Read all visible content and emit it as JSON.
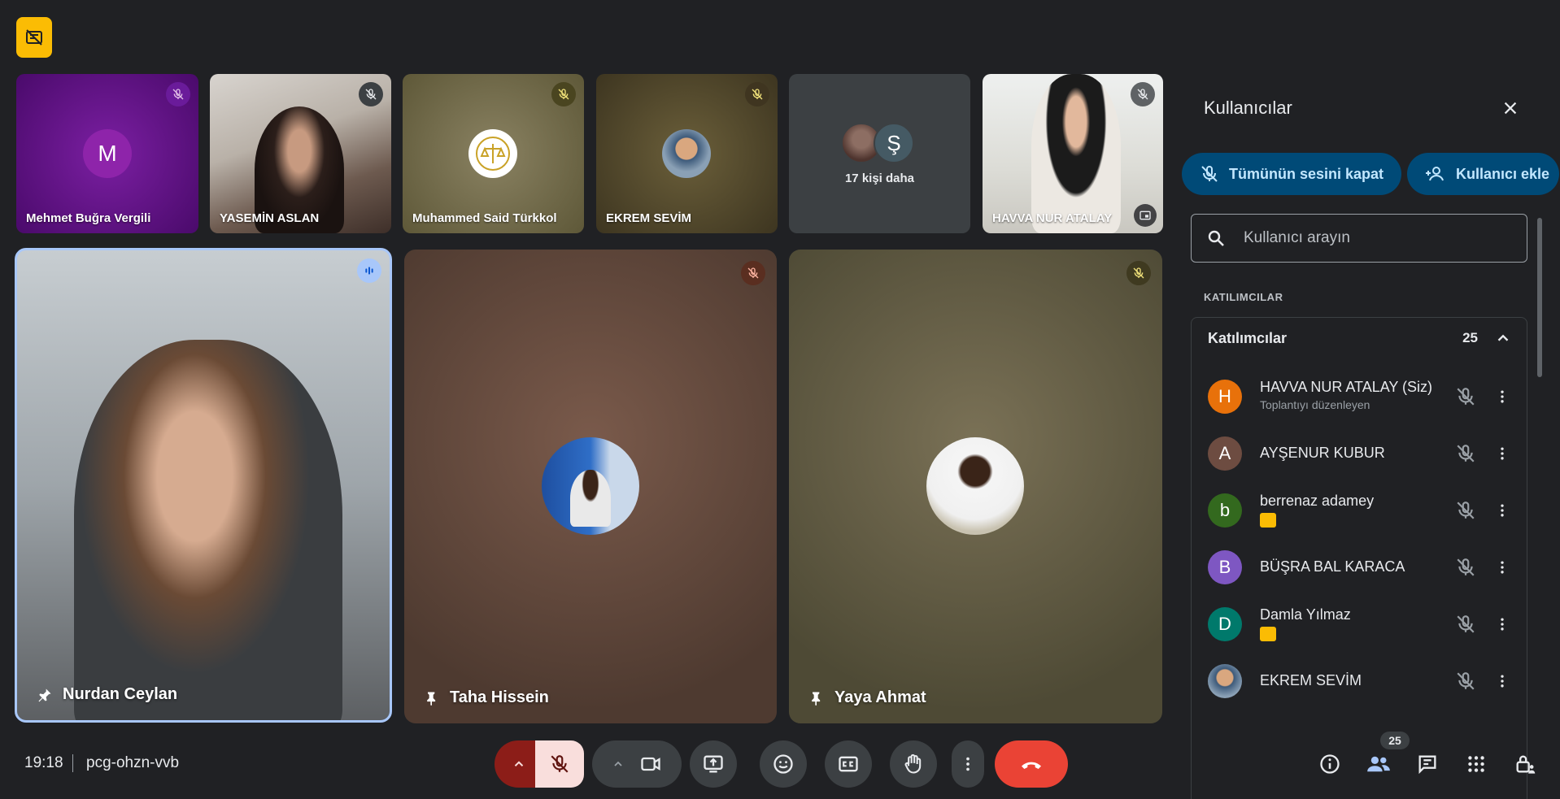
{
  "top_tiles": [
    {
      "name": "Mehmet Buğra Vergili",
      "initial": "M"
    },
    {
      "name": "YASEMİN ASLAN"
    },
    {
      "name": "Muhammed Said Türkkol"
    },
    {
      "name": "EKREM SEVİM"
    },
    {
      "more_label": "17 kişi daha",
      "initial": "Ş"
    },
    {
      "name": "HAVVA NUR ATALAY"
    }
  ],
  "main_tiles": [
    {
      "name": "Nurdan Ceylan"
    },
    {
      "name": "Taha Hissein"
    },
    {
      "name": "Yaya Ahmat"
    }
  ],
  "panel": {
    "title": "Kullanıcılar",
    "mute_all": "Tümünün sesini kapat",
    "add_user": "Kullanıcı ekle",
    "search_placeholder": "Kullanıcı arayın",
    "section_label": "KATILIMCILAR",
    "group_title": "Katılımcılar",
    "group_count": "25",
    "participants": [
      {
        "initial": "H",
        "name": "HAVVA NUR ATALAY (Siz)",
        "sub": "Toplantıyı düzenleyen",
        "color": "#e8710a"
      },
      {
        "initial": "A",
        "name": "AYŞENUR KUBUR",
        "color": "#6d4c41"
      },
      {
        "initial": "b",
        "name": "berrenaz adamey",
        "color": "#33691e"
      },
      {
        "initial": "B",
        "name": "BÜŞRA BAL KARACA",
        "color": "#7e57c2"
      },
      {
        "initial": "D",
        "name": "Damla Yılmaz",
        "color": "#00796b"
      },
      {
        "initial": "",
        "name": "EKREM SEVİM",
        "color": "#8d6e63"
      }
    ]
  },
  "bottom": {
    "time": "19:18",
    "meeting_code": "pcg-ohzn-vvb",
    "people_count": "25"
  },
  "colors": {
    "accent_blue": "#004a77",
    "end_call_red": "#ea4335",
    "mute_pink": "#f9dedc",
    "badge_yellow": "#fbbc04"
  }
}
